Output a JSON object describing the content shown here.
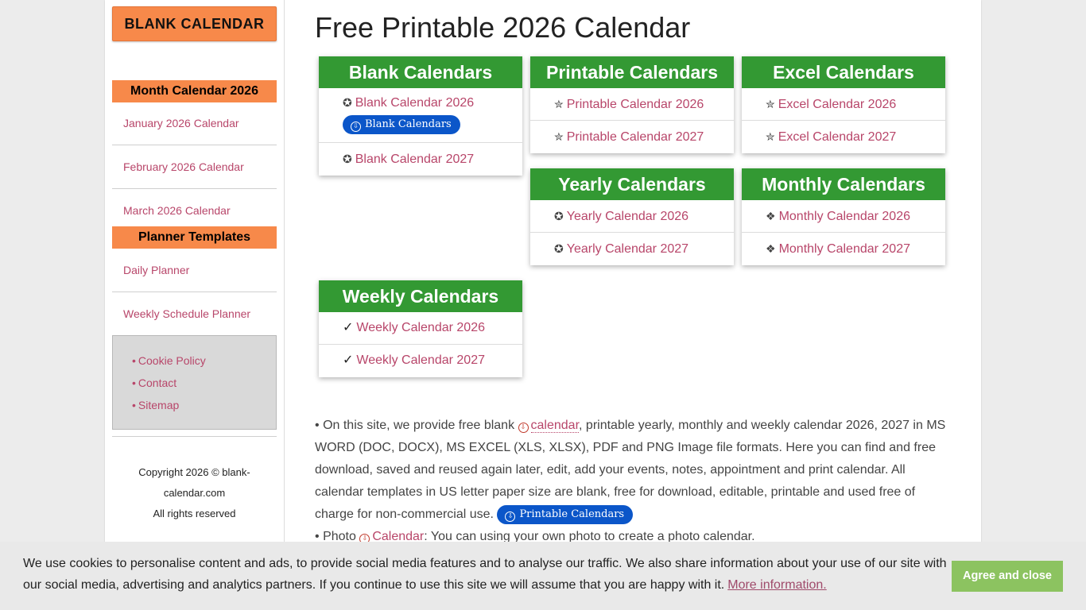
{
  "sidebar": {
    "logo_label": "BLANK CALENDAR",
    "month_heading": "Month Calendar 2026",
    "month_links": [
      "January 2026 Calendar",
      "February 2026 Calendar",
      "March 2026 Calendar"
    ],
    "planner_heading": "Planner Templates",
    "planner_links": [
      "Daily Planner",
      "Weekly Schedule Planner"
    ],
    "footer_bullet": "•",
    "footer_links": [
      "Cookie Policy",
      "Contact",
      "Sitemap"
    ],
    "copyright_line1": "Copyright 2026 © blank-",
    "copyright_line2": "calendar.com",
    "copyright_line3": "All rights reserved"
  },
  "main": {
    "title": "Free Printable 2026 Calendar",
    "cards": {
      "blank": {
        "title": "Blank Calendars",
        "symbol": "✪",
        "items": [
          "Blank Calendar 2026",
          "Blank Calendar 2027"
        ],
        "pill_label": "Blank Calendars",
        "pill_icon": "⇩"
      },
      "printable": {
        "title": "Printable Calendars",
        "symbol": "✮",
        "items": [
          "Printable Calendar 2026",
          "Printable Calendar 2027"
        ]
      },
      "excel": {
        "title": "Excel Calendars",
        "symbol": "✮",
        "items": [
          "Excel Calendar 2026",
          "Excel Calendar 2027"
        ]
      },
      "yearly": {
        "title": "Yearly Calendars",
        "symbol": "✪",
        "items": [
          "Yearly Calendar 2026",
          "Yearly Calendar 2027"
        ]
      },
      "monthly": {
        "title": "Monthly Calendars",
        "symbol": "❖",
        "items": [
          "Monthly Calendar 2026",
          "Monthly Calendar 2027"
        ]
      },
      "weekly": {
        "title": "Weekly Calendars",
        "symbol": "✓",
        "items": [
          "Weekly Calendar 2026",
          "Weekly Calendar 2027"
        ]
      }
    },
    "paragraph1": {
      "bullet": "•",
      "pre": "On this site, we provide free blank",
      "link": "calendar",
      "post": ", printable yearly, monthly and weekly calendar 2026, 2027 in MS WORD (DOC, DOCX), MS EXCEL (XLS, XLSX), PDF and PNG Image file formats. Here you can find and free download, saved and reused again later, edit, add your events, notes, appointment and print calendar. All calendar templates in US letter paper size are blank, free for download, editable, printable and used free of charge for non-commercial use.",
      "pill_label": "Printable Calendars",
      "pill_icon": "⇩",
      "link_icon": "⇩"
    },
    "paragraph2": {
      "bullet": "•",
      "pre": "Photo",
      "link": "Calendar",
      "post": ": You can using your own photo to create a photo calendar.",
      "link_icon": "⇩"
    }
  },
  "cookie": {
    "text": "We use cookies to personalise content and ads, to provide social media features and to analyse our traffic. We also share information about your use of our site with our social media, advertising and analytics partners. If you continue to use this site we will assume that you are happy with it.",
    "more_label": "More information.",
    "agree_label": "Agree and close"
  },
  "colors": {
    "orange": "#f7894a",
    "green": "#339933",
    "link": "#b8466a",
    "pill_blue": "#0b56c9",
    "agree_green": "#8cc360"
  }
}
